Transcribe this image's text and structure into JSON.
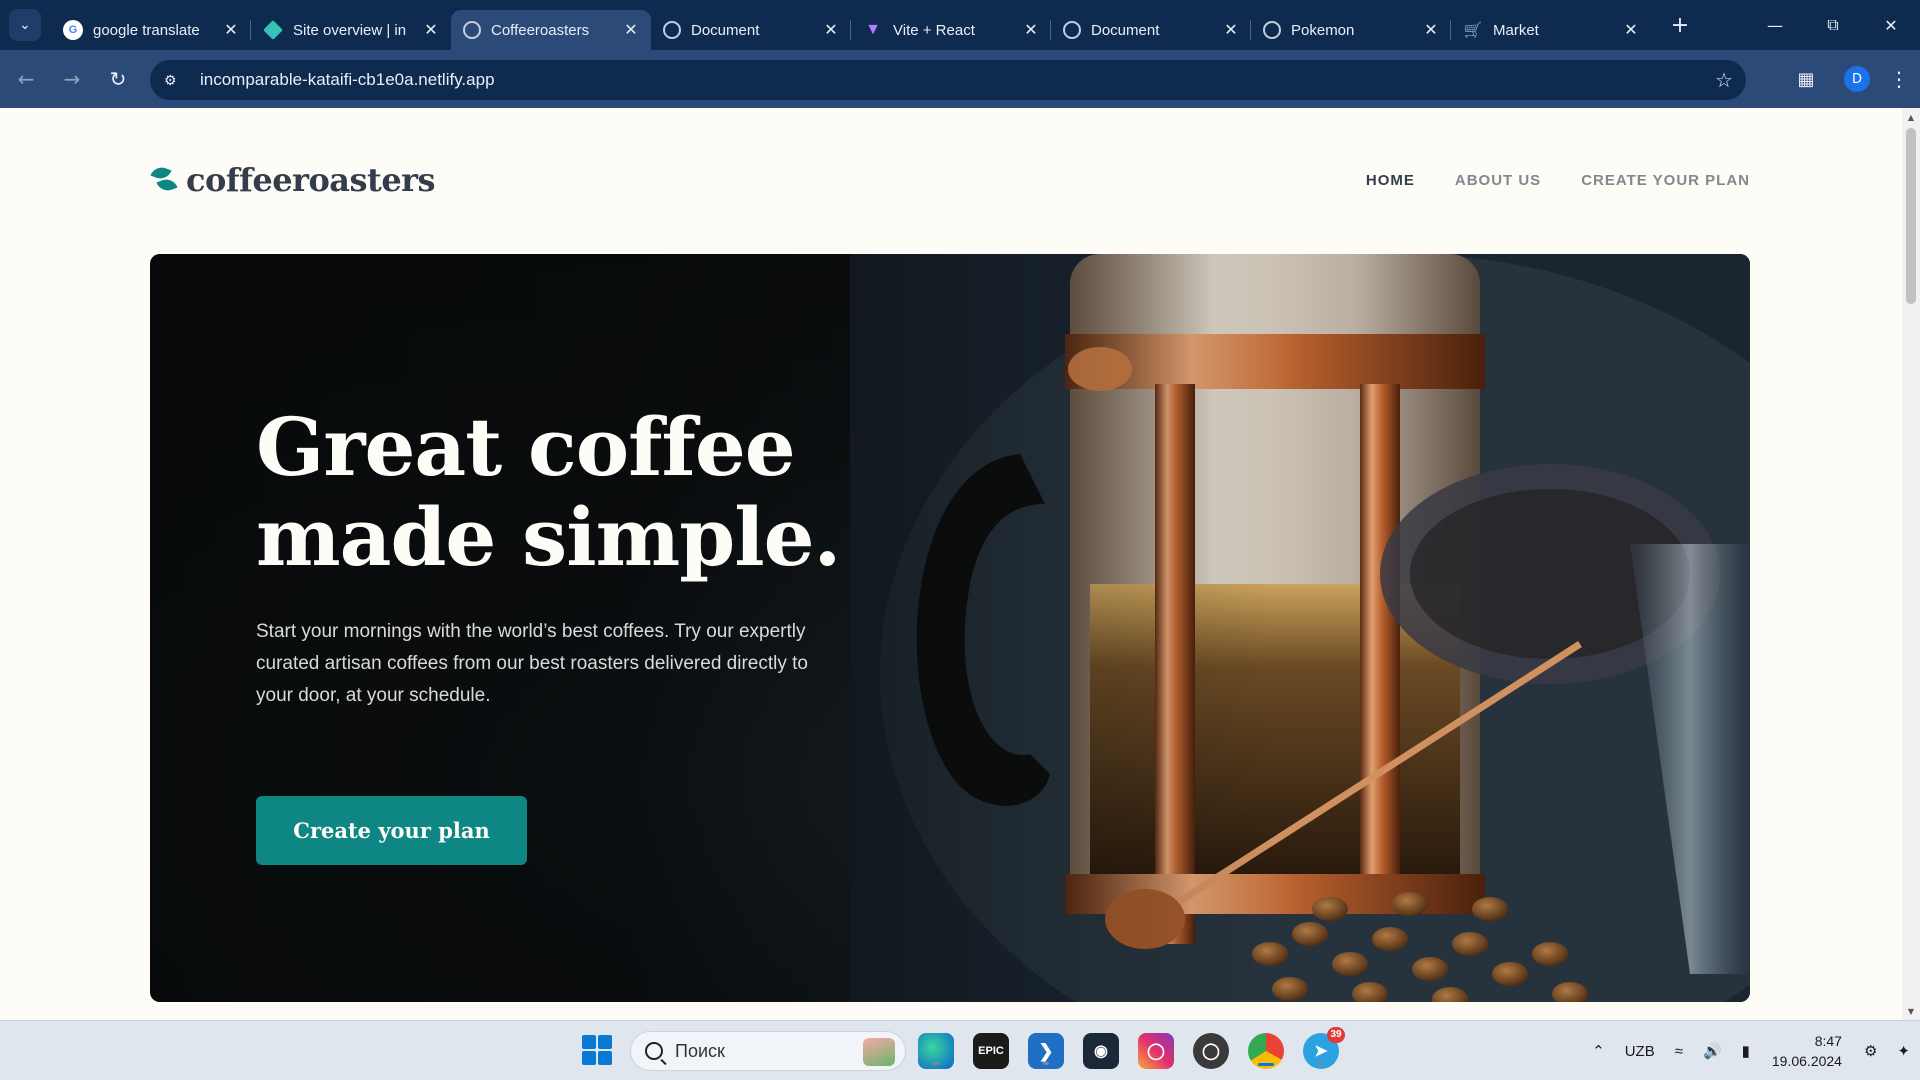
{
  "browser": {
    "tabs": [
      {
        "title": "google translate",
        "favicon": "google-icon",
        "active": false
      },
      {
        "title": "Site overview | in",
        "favicon": "netlify-icon",
        "active": false
      },
      {
        "title": "Coffeeroasters",
        "favicon": "globe-icon",
        "active": true
      },
      {
        "title": "Document",
        "favicon": "globe-icon",
        "active": false
      },
      {
        "title": "Vite + React",
        "favicon": "vite-icon",
        "active": false
      },
      {
        "title": "Document",
        "favicon": "globe-icon",
        "active": false
      },
      {
        "title": "Pokemon",
        "favicon": "globe-icon",
        "active": false
      },
      {
        "title": "Market",
        "favicon": "cart-icon",
        "active": false
      }
    ],
    "url": "incomparable-kataifi-cb1e0a.netlify.app",
    "profile_initial": "D",
    "colors": {
      "tabbar": "#0f2a4f",
      "toolbar": "#2b4a78"
    }
  },
  "site": {
    "logo_text": "coffeeroasters",
    "nav": [
      {
        "label": "HOME",
        "current": true
      },
      {
        "label": "ABOUT US",
        "current": false
      },
      {
        "label": "CREATE YOUR PLAN",
        "current": false
      }
    ],
    "hero": {
      "title_line1": "Great coffee",
      "title_line2": "made simple.",
      "text": "Start your mornings with the world’s best coffees. Try our expertly curated artisan coffees from our best roasters delivered directly to your door, at your schedule.",
      "cta_label": "Create your plan"
    },
    "colors": {
      "accent": "#0e8784",
      "dark_text": "#333d4b",
      "background": "#fefcf7"
    }
  },
  "taskbar": {
    "search_placeholder": "Поиск",
    "apps": [
      {
        "name": "edge-icon"
      },
      {
        "name": "epic-games-icon",
        "label": "EPIC"
      },
      {
        "name": "vscode-icon"
      },
      {
        "name": "steam-icon"
      },
      {
        "name": "instagram-icon"
      },
      {
        "name": "obs-icon"
      },
      {
        "name": "chrome-icon",
        "active": true
      },
      {
        "name": "telegram-icon",
        "badge": "39"
      }
    ],
    "tray": {
      "language": "UZB",
      "time": "8:47",
      "date": "19.06.2024"
    }
  }
}
